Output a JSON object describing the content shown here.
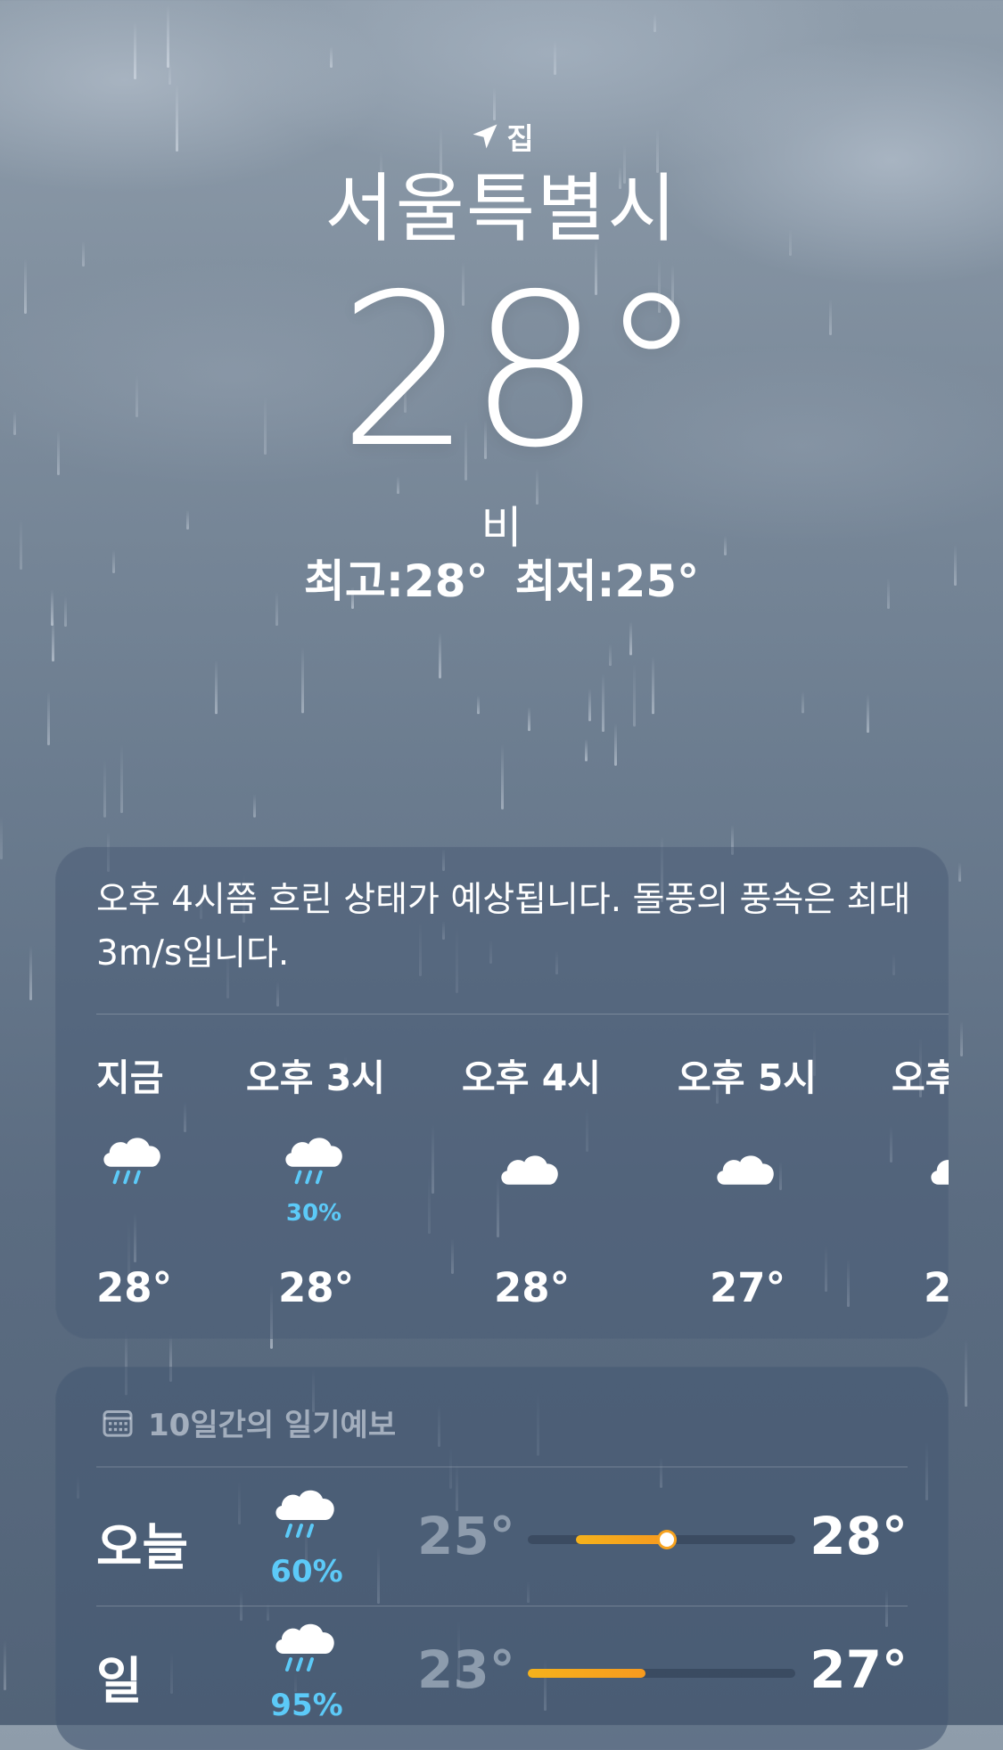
{
  "header": {
    "location_label": "집",
    "city": "서울특별시",
    "temperature": "28°",
    "condition": "비",
    "high": "최고:28°",
    "low": "최저:25°"
  },
  "hourly_card": {
    "summary": "오후 4시쯤 흐린 상태가 예상됩니다. 돌풍의 풍속은 최대 3m/s입니다.",
    "hours": [
      {
        "label": "지금",
        "icon": "cloud-rain-icon",
        "precip": "",
        "temp": "28°"
      },
      {
        "label": "오후 3시",
        "icon": "cloud-rain-icon",
        "precip": "30%",
        "temp": "28°"
      },
      {
        "label": "오후 4시",
        "icon": "cloud-icon",
        "precip": "",
        "temp": "28°"
      },
      {
        "label": "오후 5시",
        "icon": "cloud-icon",
        "precip": "",
        "temp": "27°"
      },
      {
        "label": "오후",
        "icon": "cloud-icon",
        "precip": "",
        "temp": "2"
      }
    ]
  },
  "daily_card": {
    "title": "10일간의 일기예보",
    "days": [
      {
        "day": "오늘",
        "icon": "cloud-rain-icon",
        "precip": "60%",
        "low": "25°",
        "high": "28°",
        "range_start": 0.18,
        "range_end": 0.52,
        "current": 0.52
      },
      {
        "day": "일",
        "icon": "cloud-rain-icon",
        "precip": "95%",
        "low": "23°",
        "high": "27°",
        "range_start": 0.0,
        "range_end": 0.44
      }
    ]
  },
  "colors": {
    "precip_blue": "#5ccaf8",
    "range_orange": "#f5b21c"
  }
}
